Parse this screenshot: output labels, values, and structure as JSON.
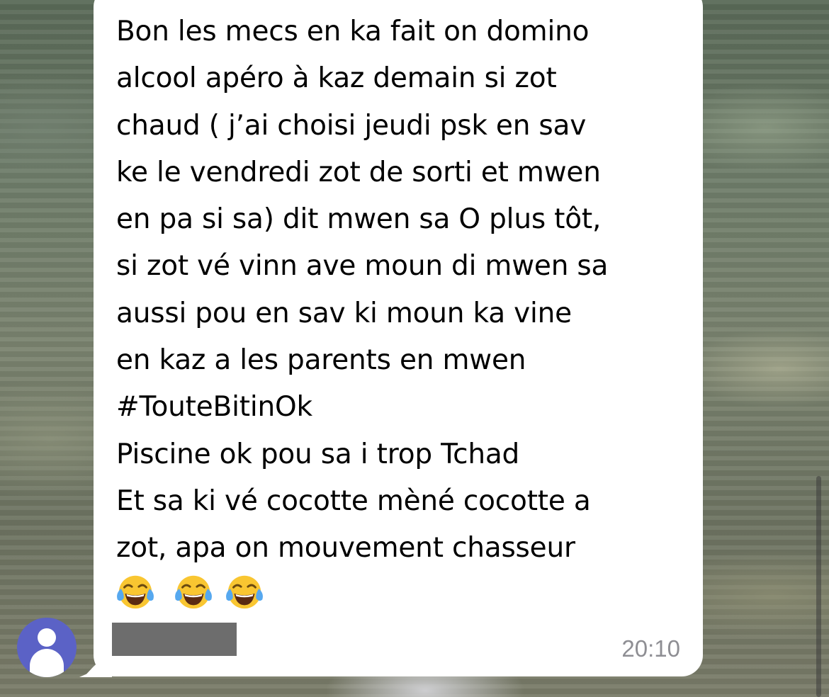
{
  "message": {
    "lines": [
      "Bon les mecs en ka fait on domino",
      "alcool apéro à kaz demain si zot",
      "chaud ( j’ai choisi jeudi psk en sav",
      "ke le vendredi zot de sorti et mwen",
      "en pa si sa) dit mwen sa O plus tôt,",
      "si zot vé vinn ave moun di mwen sa",
      "aussi pou en sav ki moun ka vine",
      "en kaz a les parents en mwen",
      "#TouteBitinOk",
      "Piscine ok pou sa i trop Tchad",
      "Et sa ki vé cocotte mèné cocotte a",
      "zot, apa on mouvement chasseur"
    ],
    "emojis": [
      "face-with-tears-of-joy-icon",
      "face-with-tears-of-joy-icon",
      "face-with-tears-of-joy-icon"
    ],
    "timestamp": "20:10",
    "sender_redacted": true
  },
  "colors": {
    "bubble": "#ffffff",
    "avatar": "#5b62c6",
    "timestamp": "#8e8e93",
    "redaction": "#6d6d6d"
  }
}
